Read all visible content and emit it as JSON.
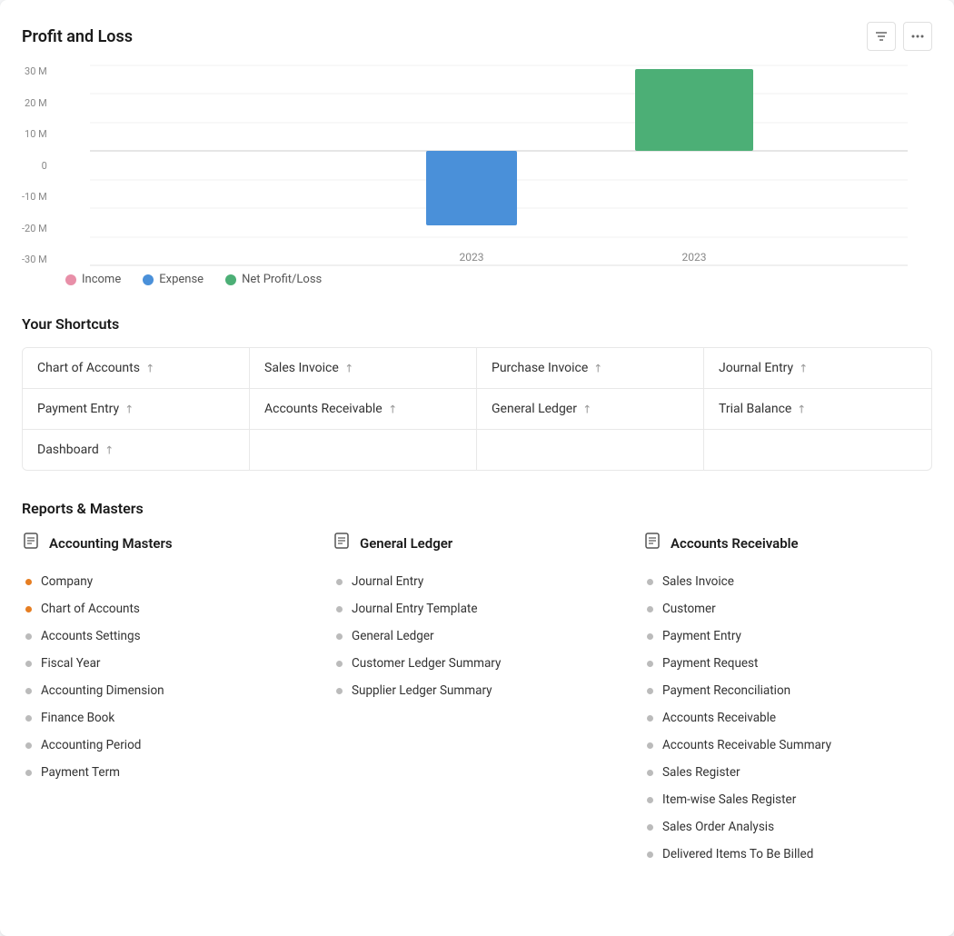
{
  "chart": {
    "title": "Profit and Loss",
    "filter_icon": "⚙",
    "more_icon": "•••",
    "y_labels": [
      "30 M",
      "20 M",
      "10 M",
      "0",
      "-10 M",
      "-20 M",
      "-30 M"
    ],
    "x_label": "2023",
    "legend": [
      {
        "id": "income",
        "label": "Income",
        "color": "#e88fa8"
      },
      {
        "id": "expense",
        "label": "Expense",
        "color": "#4a90d9"
      },
      {
        "id": "net_profit_loss",
        "label": "Net Profit/Loss",
        "color": "#4caf76"
      }
    ]
  },
  "shortcuts": {
    "title": "Your Shortcuts",
    "items": [
      {
        "id": "chart-of-accounts",
        "label": "Chart of Accounts"
      },
      {
        "id": "sales-invoice",
        "label": "Sales Invoice"
      },
      {
        "id": "purchase-invoice",
        "label": "Purchase Invoice"
      },
      {
        "id": "journal-entry",
        "label": "Journal Entry"
      },
      {
        "id": "payment-entry",
        "label": "Payment Entry"
      },
      {
        "id": "accounts-receivable",
        "label": "Accounts Receivable"
      },
      {
        "id": "general-ledger",
        "label": "General Ledger"
      },
      {
        "id": "trial-balance",
        "label": "Trial Balance"
      },
      {
        "id": "dashboard",
        "label": "Dashboard"
      }
    ]
  },
  "reports_masters": {
    "title": "Reports & Masters",
    "columns": [
      {
        "id": "accounting-masters",
        "title": "Accounting Masters",
        "items": [
          {
            "label": "Company",
            "bullet": "orange"
          },
          {
            "label": "Chart of Accounts",
            "bullet": "orange"
          },
          {
            "label": "Accounts Settings",
            "bullet": "gray"
          },
          {
            "label": "Fiscal Year",
            "bullet": "gray"
          },
          {
            "label": "Accounting Dimension",
            "bullet": "gray"
          },
          {
            "label": "Finance Book",
            "bullet": "gray"
          },
          {
            "label": "Accounting Period",
            "bullet": "gray"
          },
          {
            "label": "Payment Term",
            "bullet": "gray"
          }
        ]
      },
      {
        "id": "general-ledger",
        "title": "General Ledger",
        "items": [
          {
            "label": "Journal Entry",
            "bullet": "gray"
          },
          {
            "label": "Journal Entry Template",
            "bullet": "gray"
          },
          {
            "label": "General Ledger",
            "bullet": "gray"
          },
          {
            "label": "Customer Ledger Summary",
            "bullet": "gray"
          },
          {
            "label": "Supplier Ledger Summary",
            "bullet": "gray"
          }
        ]
      },
      {
        "id": "accounts-receivable",
        "title": "Accounts Receivable",
        "items": [
          {
            "label": "Sales Invoice",
            "bullet": "gray"
          },
          {
            "label": "Customer",
            "bullet": "gray"
          },
          {
            "label": "Payment Entry",
            "bullet": "gray"
          },
          {
            "label": "Payment Request",
            "bullet": "gray"
          },
          {
            "label": "Payment Reconciliation",
            "bullet": "gray"
          },
          {
            "label": "Accounts Receivable",
            "bullet": "gray"
          },
          {
            "label": "Accounts Receivable Summary",
            "bullet": "gray"
          },
          {
            "label": "Sales Register",
            "bullet": "gray"
          },
          {
            "label": "Item-wise Sales Register",
            "bullet": "gray"
          },
          {
            "label": "Sales Order Analysis",
            "bullet": "gray"
          },
          {
            "label": "Delivered Items To Be Billed",
            "bullet": "gray"
          }
        ]
      }
    ]
  }
}
